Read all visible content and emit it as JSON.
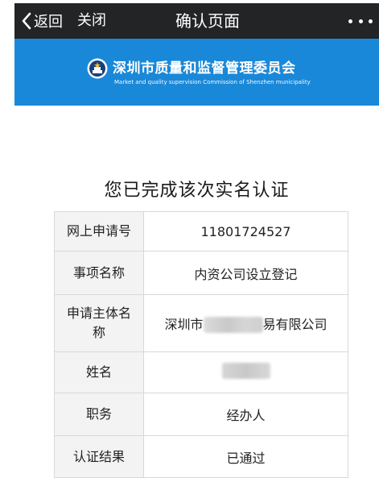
{
  "navbar": {
    "back_label": "返回",
    "close_label": "关闭",
    "title": "确认页面",
    "more_icon": "more-dots-icon"
  },
  "banner": {
    "title": "深圳市质量和监督管理委员会",
    "subtitle": "Market and quality supervision Commission of Shenzhen municipality",
    "emblem_icon": "national-emblem-icon",
    "color": "#1a88d8"
  },
  "page_title": "您已完成该次实名认证",
  "table": [
    {
      "label": "网上申请号",
      "value": "11801724527"
    },
    {
      "label": "事项名称",
      "value": "内资公司设立登记"
    },
    {
      "label": "申请主体名称",
      "value_prefix": "深圳市",
      "value_suffix": "易有限公司"
    },
    {
      "label": "姓名"
    },
    {
      "label": "职务",
      "value": "经办人"
    },
    {
      "label": "认证结果",
      "value": "已通过"
    }
  ]
}
